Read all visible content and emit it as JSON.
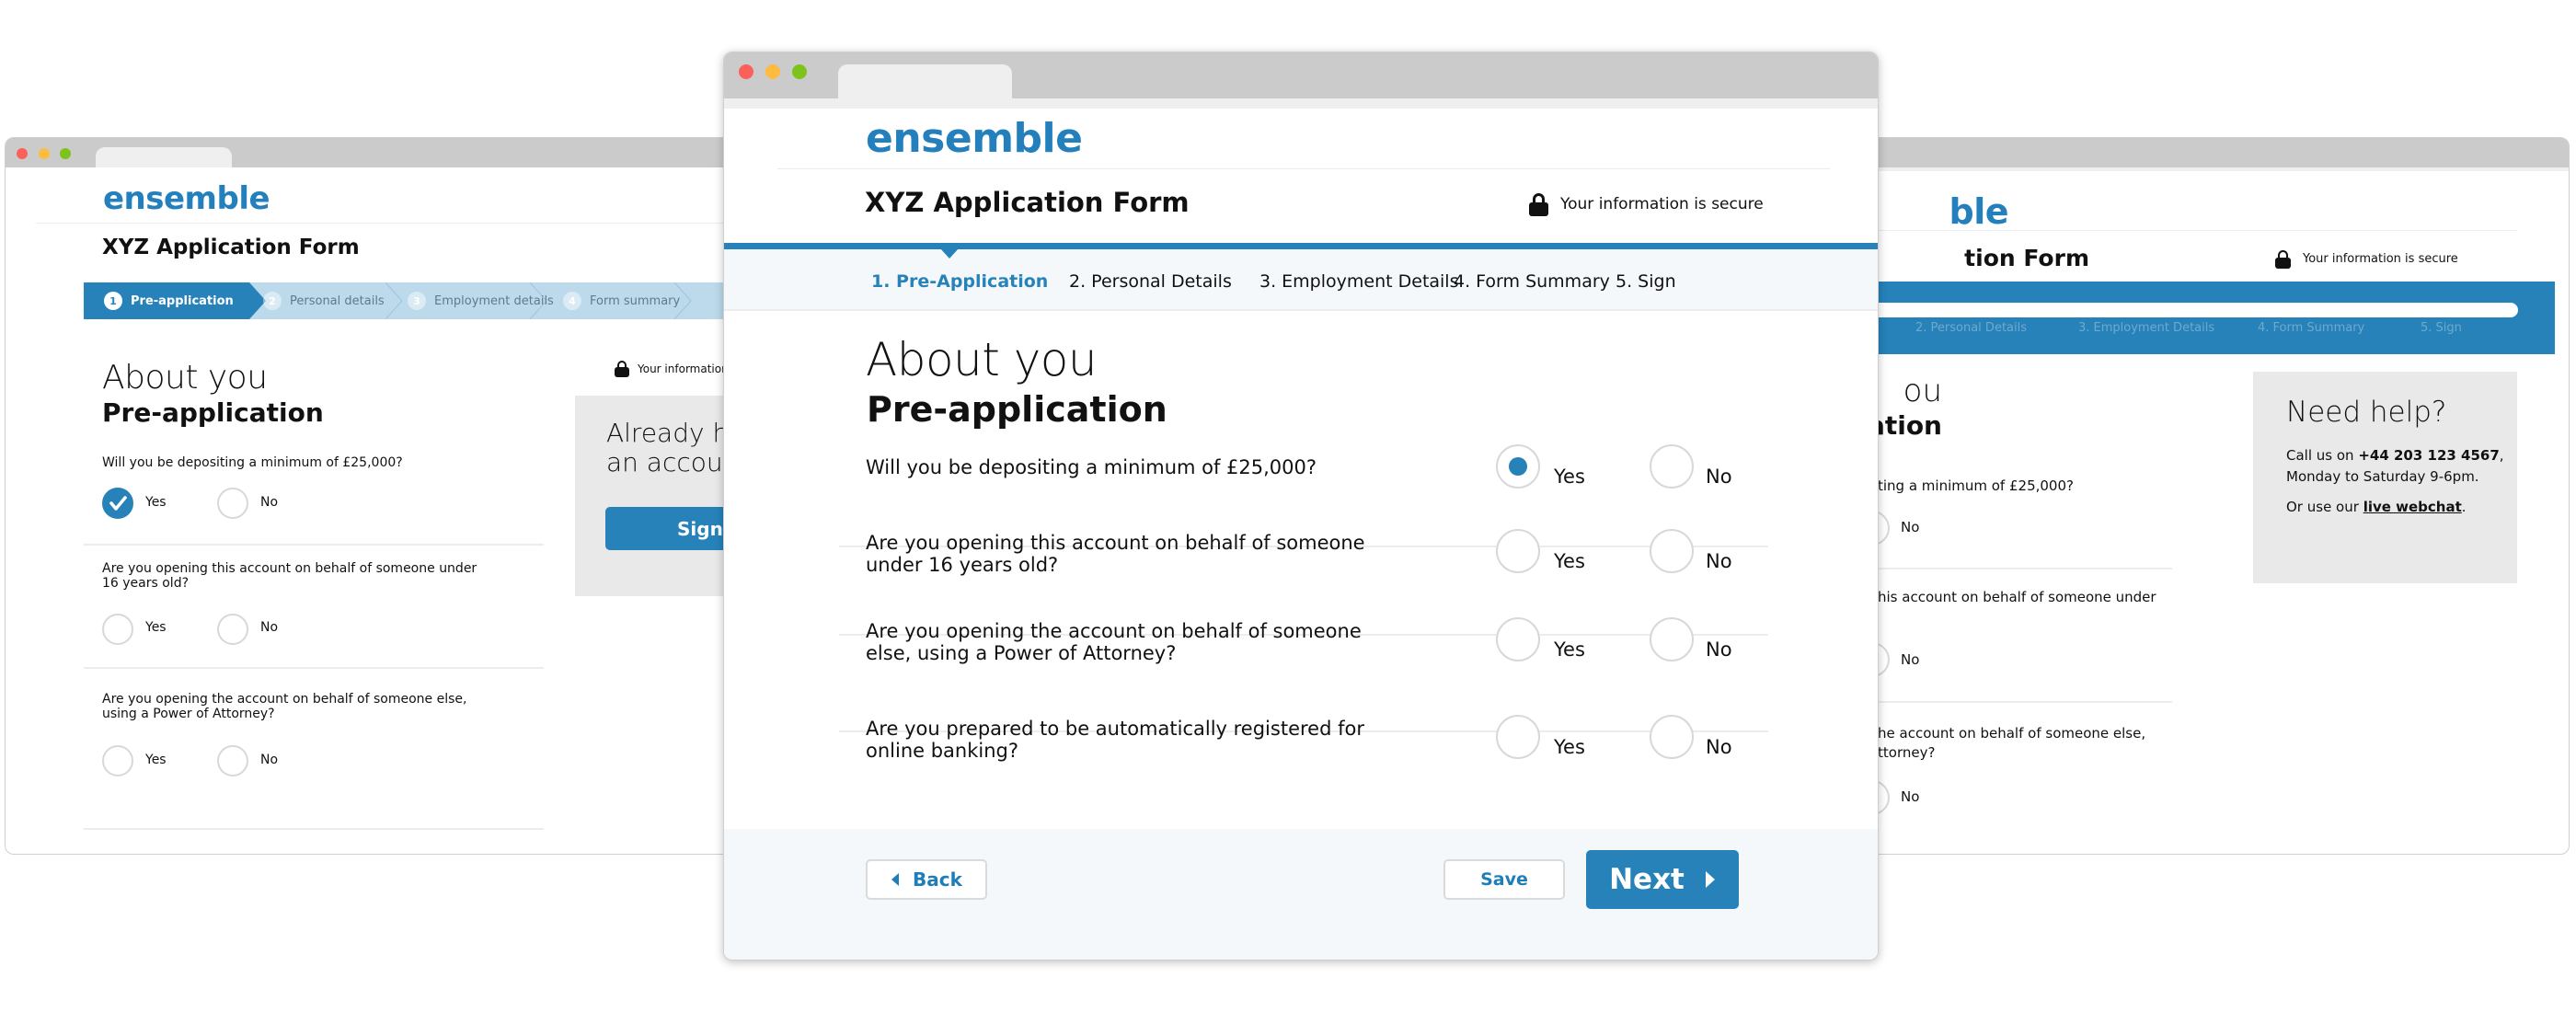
{
  "brand": {
    "logo": "ensemble",
    "accent_color": "#2682b9",
    "progress_marker_color": "#e6e600"
  },
  "form_title": "XYZ Application Form",
  "secure_notice": "Your information is secure",
  "section": {
    "heading": "About you",
    "subheading": "Pre-application"
  },
  "options": {
    "yes": "Yes",
    "no": "No"
  },
  "center_steps": [
    {
      "label": "1. Pre-Application",
      "active": true
    },
    {
      "label": "2. Personal Details",
      "active": false
    },
    {
      "label": "3. Employment Details",
      "active": false
    },
    {
      "label": "4. Form Summary",
      "active": false
    },
    {
      "label": "5. Sign",
      "active": false
    }
  ],
  "left_steps": [
    {
      "num": "1",
      "label": "Pre-application",
      "active": true
    },
    {
      "num": "2",
      "label": "Personal details",
      "active": false
    },
    {
      "num": "3",
      "label": "Employment details",
      "active": false
    },
    {
      "num": "4",
      "label": "Form summary",
      "active": false
    }
  ],
  "questions": [
    {
      "text": "Will you be depositing a minimum of £25,000?",
      "selected": "yes"
    },
    {
      "text": "Are you opening this account on behalf of someone under 16 years old?",
      "selected": null
    },
    {
      "text": "Are you opening the account on behalf of someone else, using a Power of Attorney?",
      "selected": null
    },
    {
      "text": "Are you prepared to be automatically registered for online banking?",
      "selected": null
    }
  ],
  "left_questions": [
    {
      "line1": "Will you be depositing a minimum of £25,000?",
      "line2": "",
      "selected": "yes"
    },
    {
      "line1": "Are you opening this account on behalf of someone under",
      "line2": "16 years old?",
      "selected": null
    },
    {
      "line1": "Are you opening the account on behalf of someone else,",
      "line2": "using a Power of Attorney?",
      "selected": null
    }
  ],
  "right_questions": [
    {
      "line1": "ting a minimum of £25,000?",
      "line2": ""
    },
    {
      "line1": "his account on behalf of someone under",
      "line2": ""
    },
    {
      "line1": "he account on behalf of someone else,",
      "line2": "ttorney?"
    }
  ],
  "right_partial": {
    "logo_fragment": "ble",
    "title_fragment": "tion Form",
    "heading_fragment": "ou",
    "subheading_fragment": "cation"
  },
  "signin_box": {
    "heading_line1": "Already h",
    "heading_line2": "an accoun",
    "button": "Sign in"
  },
  "help_box": {
    "heading": "Need help?",
    "call_prefix": "Call us on ",
    "phone": "+44 203 123 4567",
    "call_suffix": ",",
    "hours": "Monday to Saturday 9-6pm.",
    "webchat_prefix": "Or use our ",
    "webchat_link": "live webchat",
    "webchat_suffix": "."
  },
  "right_progress": {
    "current_step": 1,
    "total_steps": 5
  },
  "footer": {
    "back": "Back",
    "save": "Save",
    "next": "Next"
  }
}
